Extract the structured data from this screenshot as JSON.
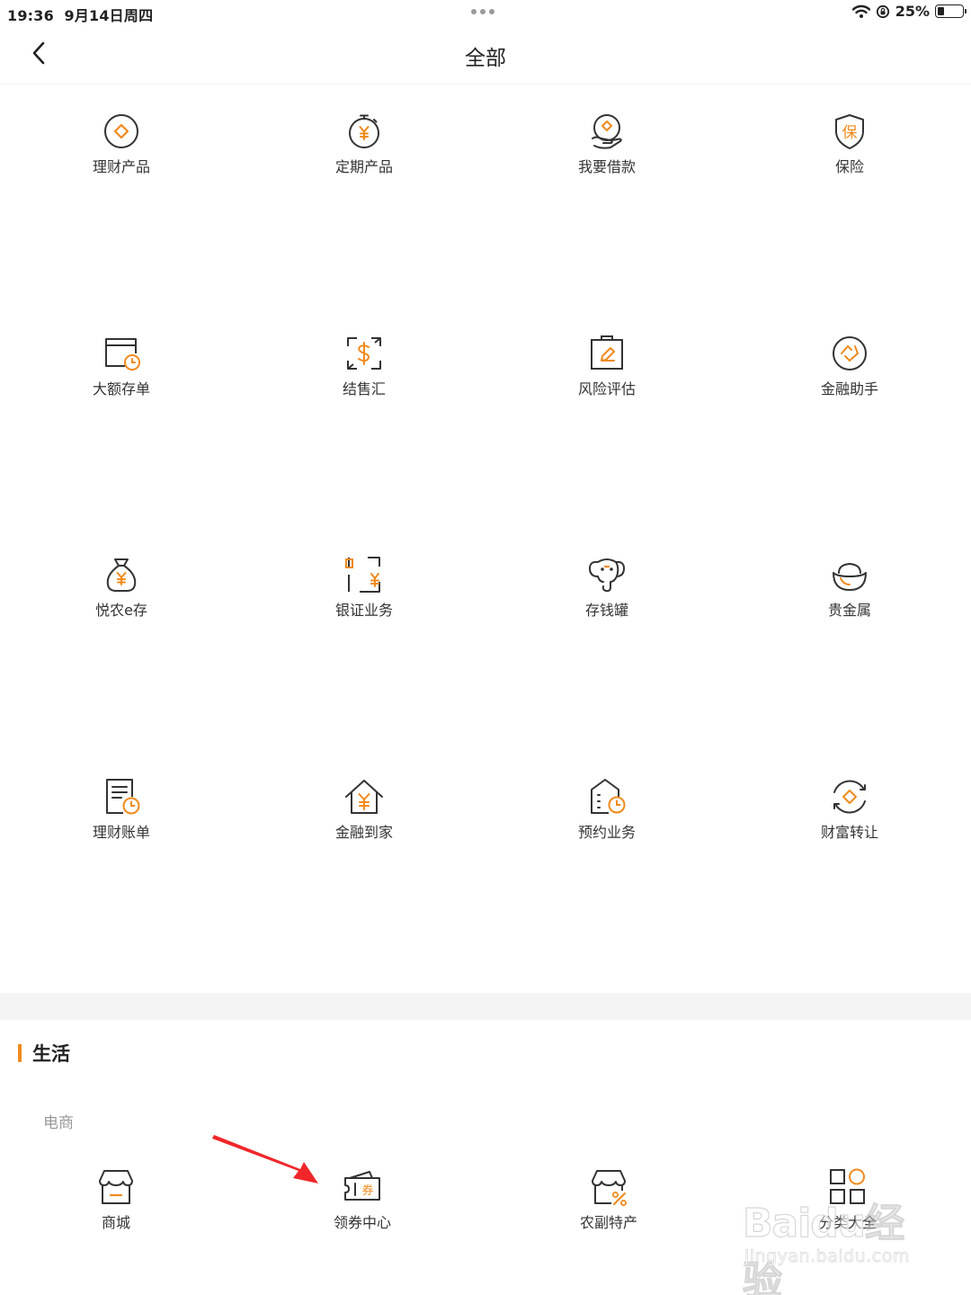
{
  "status_bar": {
    "time": "19:36",
    "date": "9月14日周四",
    "battery": "25%",
    "battery_level": 0.25
  },
  "nav": {
    "title": "全部",
    "back_icon": "chevron-left-icon"
  },
  "colors": {
    "accent": "#f08a1c",
    "line": "#333333",
    "divider": "#f4f4f4"
  },
  "grid": [
    {
      "label": "理财产品",
      "icon": "diamond-coin-icon"
    },
    {
      "label": "定期产品",
      "icon": "yuan-stopwatch-icon"
    },
    {
      "label": "我要借款",
      "icon": "hand-coin-icon"
    },
    {
      "label": "保险",
      "icon": "shield-icon"
    },
    {
      "label": "大额存单",
      "icon": "wallet-clock-icon"
    },
    {
      "label": "结售汇",
      "icon": "dollar-exchange-icon"
    },
    {
      "label": "风险评估",
      "icon": "clipboard-pen-icon"
    },
    {
      "label": "金融助手",
      "icon": "diamond-circle-icon"
    },
    {
      "label": "悦农e存",
      "icon": "money-bag-icon"
    },
    {
      "label": "银证业务",
      "icon": "stock-yuan-icon"
    },
    {
      "label": "存钱罐",
      "icon": "elephant-icon"
    },
    {
      "label": "贵金属",
      "icon": "gold-ingot-icon"
    },
    {
      "label": "理财账单",
      "icon": "bill-clock-icon"
    },
    {
      "label": "金融到家",
      "icon": "house-yuan-icon"
    },
    {
      "label": "预约业务",
      "icon": "house-clock-icon"
    },
    {
      "label": "财富转让",
      "icon": "diamond-transfer-icon"
    }
  ],
  "life_section": {
    "title": "生活",
    "subsection": "电商",
    "items": [
      {
        "label": "商城",
        "icon": "shop-icon"
      },
      {
        "label": "领券中心",
        "icon": "coupon-icon",
        "coupon_char": "券"
      },
      {
        "label": "农副特产",
        "icon": "shop-percent-icon"
      },
      {
        "label": "分类大全",
        "icon": "category-grid-icon"
      }
    ]
  },
  "watermark": {
    "brand": "Baidu经验",
    "url": "jingyan.baidu.com"
  }
}
